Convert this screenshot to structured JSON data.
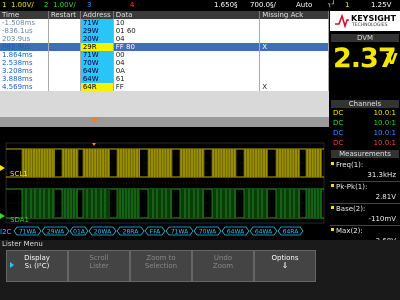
{
  "status_bar": {
    "ch1_num": "1",
    "ch1_scale": "1.00V/",
    "ch2_num": "2",
    "ch2_scale": "1.00V/",
    "ch3_num": "3",
    "ch4_num": "4",
    "timebase_pos": "1.650§",
    "timebase_scale": "700.0§/",
    "trig_mode": "Auto",
    "trig_src": "1",
    "trig_level": "1.25V"
  },
  "lister": {
    "columns": [
      "Time",
      "Restart",
      "Address",
      "Data",
      "Missing Ack"
    ],
    "rows": [
      {
        "time": "-1.508ms",
        "restart": "",
        "address": "71W",
        "data": "10",
        "ack": "",
        "style": "dim"
      },
      {
        "time": "-836.1us",
        "restart": "",
        "address": "29W",
        "data": "01 60",
        "ack": "",
        "style": "dim"
      },
      {
        "time": "203.9us",
        "restart": "",
        "address": "20W",
        "data": "04",
        "ack": "",
        "style": "dim"
      },
      {
        "time": "883.9us",
        "restart": "",
        "address": "29R",
        "data": "FF 80",
        "ack": "X",
        "style": "sel"
      },
      {
        "time": "1.864ms",
        "restart": "",
        "address": "71W",
        "data": "00",
        "ack": "",
        "style": "normal"
      },
      {
        "time": "2.538ms",
        "restart": "",
        "address": "70W",
        "data": "04",
        "ack": "",
        "style": "normal"
      },
      {
        "time": "3.208ms",
        "restart": "",
        "address": "64W",
        "data": "0A",
        "ack": "",
        "style": "normal"
      },
      {
        "time": "3.888ms",
        "restart": "",
        "address": "64W",
        "data": "61",
        "ack": "",
        "style": "normal"
      },
      {
        "time": "4.569ms",
        "restart": "",
        "address": "64R",
        "data": "FF",
        "ack": "X",
        "style": "normal"
      }
    ]
  },
  "side": {
    "brand": "KEYSIGHT",
    "brand_sub": "TECHNOLOGIES",
    "dvm_title": "DVM",
    "dvm_value": "2.37",
    "dvm_unit": "V",
    "channels_title": "Channels",
    "channels": [
      {
        "coupling": "DC",
        "ratio": "10.0:1",
        "color": "#f5e600"
      },
      {
        "coupling": "DC",
        "ratio": "10.0:1",
        "color": "#33d633"
      },
      {
        "coupling": "DC",
        "ratio": "10.0:1",
        "color": "#3b8cff"
      },
      {
        "coupling": "DC",
        "ratio": "10.0:1",
        "color": "#ff3b3b"
      }
    ],
    "measurements_title": "Measurements",
    "measurements": [
      {
        "label": "Freq(1):",
        "value": "31.3kHz"
      },
      {
        "label": "Pk-Pk(1):",
        "value": "2.81V"
      },
      {
        "label": "Base(2):",
        "value": "-110mV"
      },
      {
        "label": "Max(2):",
        "value": "2.68V"
      }
    ]
  },
  "waveform": {
    "scl_label": "SCL1",
    "sda_label": "SDA1",
    "bus_label": "I2C",
    "decodes": [
      "71WA",
      "29WA",
      "01A",
      "20WA",
      "28RA",
      "FFA",
      "71WA",
      "70WA",
      "64WA",
      "64WA",
      "64RA"
    ]
  },
  "menu": {
    "title": "Lister Menu",
    "softkeys": [
      {
        "line1": "Display",
        "line2": "S₁ (I²C)",
        "enabled": true
      },
      {
        "line1": "Scroll",
        "line2": "Lister",
        "enabled": false
      },
      {
        "line1": "Zoom to",
        "line2": "Selection",
        "enabled": false
      },
      {
        "line1": "Undo",
        "line2": "Zoom",
        "enabled": false
      },
      {
        "line1": "Options",
        "line2": "",
        "enabled": true
      }
    ]
  },
  "colors": {
    "ch1": "#f5e600",
    "ch2": "#33d633",
    "ch3": "#3b8cff",
    "ch4": "#ff3b3b",
    "decode": "#29c5f6",
    "dvm": "#f5e600"
  }
}
